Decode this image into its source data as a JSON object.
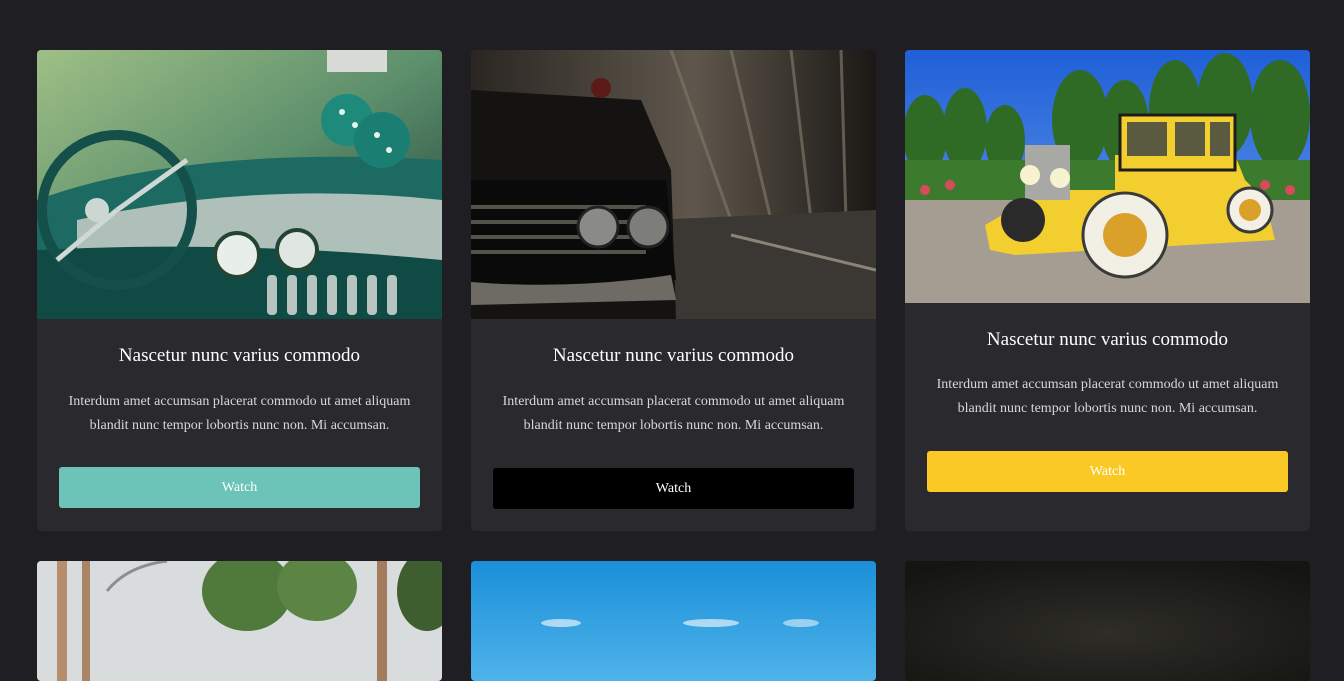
{
  "cards": [
    {
      "title": "Nascetur nunc varius commodo",
      "description": "Interdum amet accumsan placerat commodo ut amet aliquam blandit nunc tempor lobortis nunc non. Mi accumsan.",
      "button_label": "Watch",
      "button_color": "#6cc4b8",
      "image": "teal-vintage-car-dashboard"
    },
    {
      "title": "Nascetur nunc varius commodo",
      "description": "Interdum amet accumsan placerat commodo ut amet aliquam blandit nunc tempor lobortis nunc non. Mi accumsan.",
      "button_label": "Watch",
      "button_color": "#000000",
      "image": "dark-vintage-car-front"
    },
    {
      "title": "Nascetur nunc varius commodo",
      "description": "Interdum amet accumsan placerat commodo ut amet aliquam blandit nunc tempor lobortis nunc non. Mi accumsan.",
      "button_label": "Watch",
      "button_color": "#fbc926",
      "image": "yellow-classic-car-park"
    },
    {
      "image": "palm-trees-street"
    },
    {
      "image": "blue-sky"
    },
    {
      "image": "dark-night"
    }
  ],
  "colors": {
    "page_background": "#1f1e23",
    "card_background": "#2a292e"
  }
}
